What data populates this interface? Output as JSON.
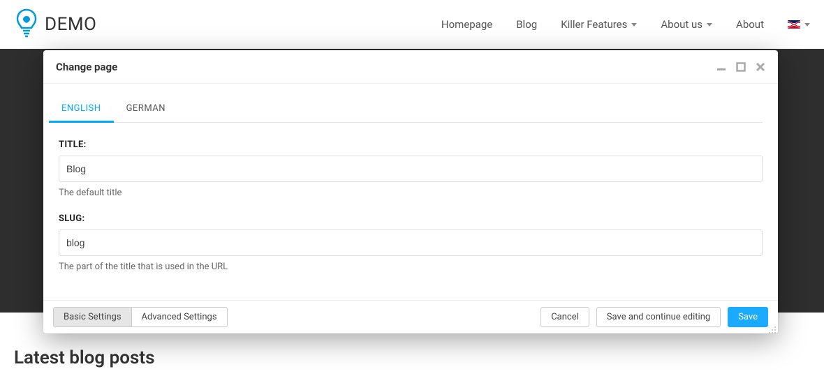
{
  "brand": {
    "text": "DEMO"
  },
  "nav": {
    "items": [
      {
        "label": "Homepage",
        "dropdown": false
      },
      {
        "label": "Blog",
        "dropdown": false
      },
      {
        "label": "Killer Features",
        "dropdown": true
      },
      {
        "label": "About us",
        "dropdown": true
      },
      {
        "label": "About",
        "dropdown": false
      }
    ]
  },
  "page": {
    "latest_heading": "Latest blog posts"
  },
  "modal": {
    "title": "Change page",
    "lang_tabs": [
      {
        "label": "ENGLISH",
        "active": true
      },
      {
        "label": "GERMAN",
        "active": false
      }
    ],
    "fields": {
      "title": {
        "label": "TITLE:",
        "value": "Blog",
        "help": "The default title"
      },
      "slug": {
        "label": "SLUG:",
        "value": "blog",
        "help": "The part of the title that is used in the URL"
      }
    },
    "footer": {
      "segments": [
        {
          "label": "Basic Settings",
          "active": true
        },
        {
          "label": "Advanced Settings",
          "active": false
        }
      ],
      "cancel": "Cancel",
      "save_continue": "Save and continue editing",
      "save": "Save"
    }
  }
}
